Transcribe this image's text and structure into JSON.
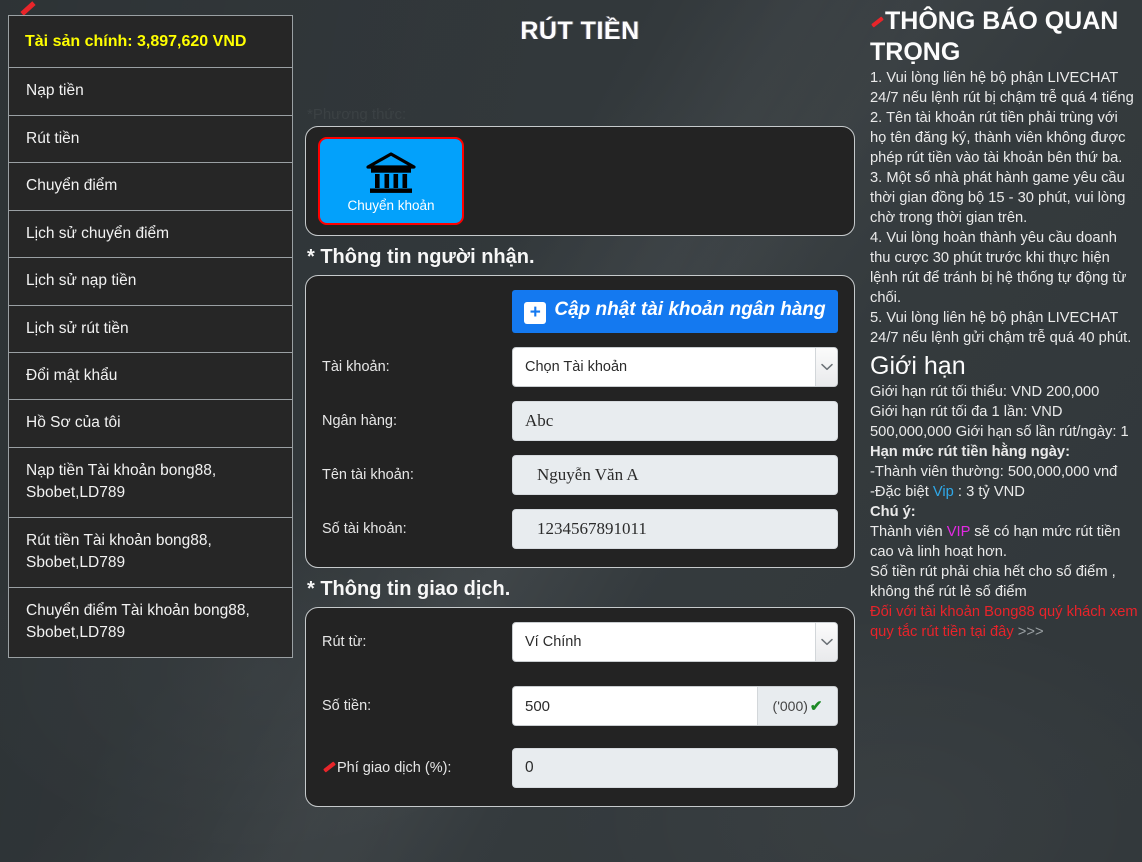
{
  "sidebar": {
    "balance": "Tài sản chính: 3,897,620 VND",
    "items": [
      {
        "label": "Nạp tiền"
      },
      {
        "label": "Rút tiền"
      },
      {
        "label": "Chuyển điểm"
      },
      {
        "label": "Lịch sử chuyển điểm"
      },
      {
        "label": "Lịch sử nạp tiền"
      },
      {
        "label": "Lịch sử rút tiền"
      },
      {
        "label": "Đổi mật khẩu"
      },
      {
        "label": "Hồ Sơ của tôi"
      },
      {
        "label": "Nạp tiền Tài khoản bong88, Sbobet,LD789"
      },
      {
        "label": "Rút tiền Tài khoản bong88, Sbobet,LD789"
      },
      {
        "label": "Chuyển điểm Tài khoản bong88, Sbobet,LD789"
      }
    ]
  },
  "main": {
    "page_title": "RÚT TIỀN",
    "method_label": "*Phương thức:",
    "method_card_label": "Chuyển khoản",
    "recipient_heading": "* Thông tin người nhận.",
    "update_bank_button": "Cập nhật tài khoản ngân hàng",
    "update_bank_plus": "+",
    "fields": {
      "account_label": "Tài khoản:",
      "account_value": "Chọn Tài khoản",
      "bank_label": "Ngân hàng:",
      "bank_value": "Abc",
      "account_name_label": "Tên tài khoản:",
      "account_name_value": "Nguyễn Văn A",
      "account_number_label": "Số tài khoản:",
      "account_number_value": "1234567891011"
    },
    "transaction_heading": "* Thông tin giao dịch.",
    "transaction": {
      "withdraw_from_label": "Rút từ:",
      "withdraw_from_value": "Ví Chính",
      "amount_label": "Số tiền:",
      "amount_value": "500",
      "amount_suffix": "('000)",
      "fee_label": "Phí giao dịch (%):",
      "fee_value": "0"
    }
  },
  "notice": {
    "title": "THÔNG BÁO QUAN TRỌNG",
    "items": [
      "1. Vui lòng liên hệ bộ phận LIVECHAT 24/7 nếu lệnh rút bị chậm trễ quá 4 tiếng",
      "2. Tên tài khoản rút tiền phải trùng với họ tên đăng ký, thành viên không được phép rút tiền vào tài khoản bên thứ ba.",
      "3. Một số nhà phát hành game yêu cầu thời gian đồng bộ 15 - 30 phút, vui lòng chờ trong thời gian trên.",
      "4. Vui lòng hoàn thành yêu cầu doanh thu cược 30 phút trước khi thực hiện lệnh rút để tránh bị hệ thống tự động từ chối.",
      "5. Vui lòng liên hệ bộ phận LIVECHAT 24/7 nếu lệnh gửi chậm trễ quá 40 phút."
    ],
    "limit_title": "Giới hạn",
    "limit_min": "Giới hạn rút tối thiểu: VND 200,000",
    "limit_max": "Giới hạn rút tối đa 1 lần: VND 500,000,000 Giới hạn số lần rút/ngày: 1",
    "daily_title": "Hạn mức rút tiền hằng ngày:",
    "daily_normal": "-Thành viên thường: 500,000,000 vnđ",
    "daily_special_prefix": "-Đặc biệt ",
    "daily_special_vip": "Vip",
    "daily_special_suffix": " : 3 tỷ VND",
    "note_title": "Chú ý:",
    "note_line1_prefix": "Thành viên ",
    "note_line1_vip": "VIP",
    "note_line1_suffix": " sẽ có hạn mức rút tiền cao và linh hoạt hơn.",
    "note_line2": "Số tiền rút phải chia hết cho số điểm , không thể rút lẻ số điểm",
    "red_link": "Đối với tài khoản Bong88 quý khách xem quy tắc rút tiền tại đây",
    "red_link_arrows": " >>>"
  },
  "colors": {
    "accent_blue": "#03a1fb",
    "button_blue": "#1479f0",
    "balance_yellow": "#ffff00",
    "red": "#e8232a",
    "vip_cyan": "#2fa8e8",
    "vip_magenta": "#e22ae2",
    "check_green": "#1d8a25"
  }
}
